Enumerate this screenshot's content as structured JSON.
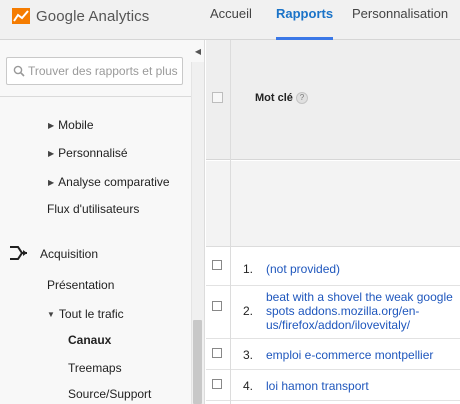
{
  "app": {
    "title": "Google Analytics",
    "brand_color": "#f57c00"
  },
  "nav": {
    "tabs": [
      {
        "label": "Accueil",
        "active": false
      },
      {
        "label": "Rapports",
        "active": true
      },
      {
        "label": "Personnalisation",
        "active": false
      }
    ]
  },
  "sidebar": {
    "search": {
      "placeholder": "Trouver des rapports et plus",
      "icon": "search-icon"
    },
    "collapse_icon": "chevron-left-icon",
    "items": [
      {
        "label": "Mobile",
        "expandable": true
      },
      {
        "label": "Personnalisé",
        "expandable": true
      },
      {
        "label": "Analyse comparative",
        "expandable": true
      },
      {
        "label": "Flux d'utilisateurs",
        "expandable": false
      },
      {
        "label": "Acquisition",
        "icon": "acquisition-icon"
      },
      {
        "label": "Présentation",
        "expandable": false
      },
      {
        "label": "Tout le trafic",
        "expanded": true
      },
      {
        "label": "Canaux",
        "selected": true
      },
      {
        "label": "Treemaps"
      },
      {
        "label": "Source/Support"
      }
    ]
  },
  "table": {
    "column_header": "Mot clé",
    "help_icon": "?",
    "rows": [
      {
        "num": "1.",
        "keyword": "(not provided)"
      },
      {
        "num": "2.",
        "keyword": "beat with a shovel the weak google spots addons.mozilla.org/en-us/firefox/addon/ilovevitaly/"
      },
      {
        "num": "3.",
        "keyword": "emploi e-commerce montpellier"
      },
      {
        "num": "4.",
        "keyword": "loi hamon transport"
      }
    ]
  }
}
